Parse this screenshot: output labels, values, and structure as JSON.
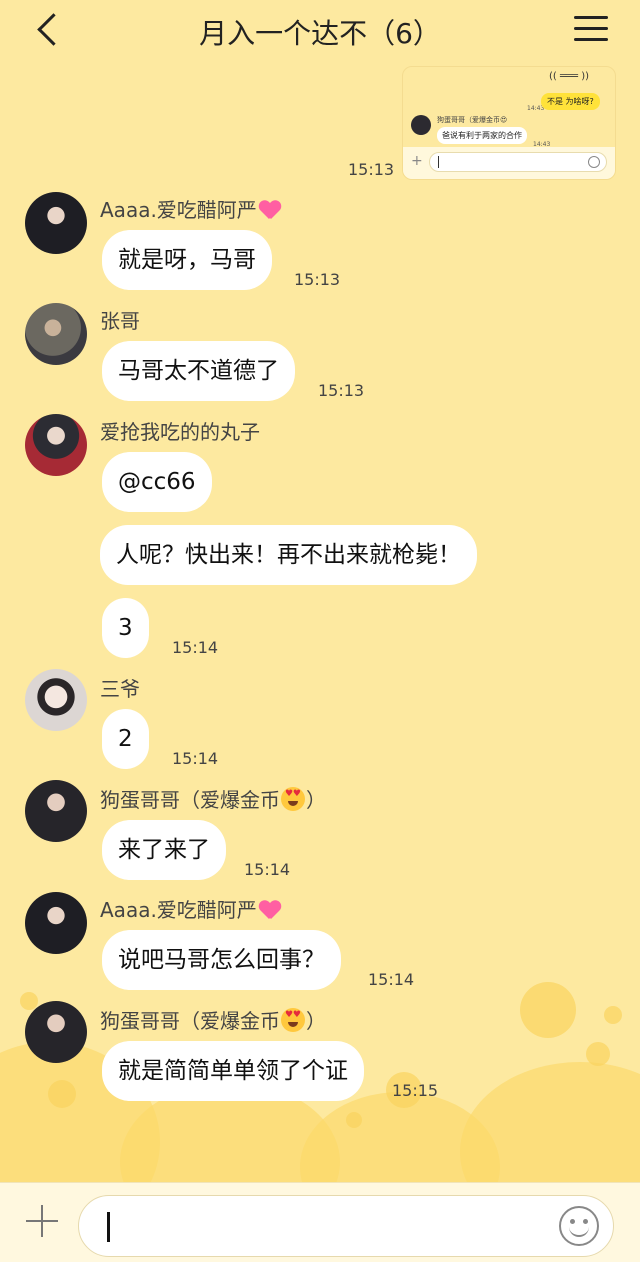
{
  "header": {
    "title": "月入一个达不（6）",
    "back_icon": "chevron-left-icon",
    "menu_icon": "menu-icon"
  },
  "screenshot_message": {
    "meme_text": "(( ═══ ))",
    "yellow_bubble": "不是 为啥呀?",
    "time_top": "14:43",
    "sender": "狗蛋哥哥（爱爆金币😍",
    "white_bubble": "爸说有利于两家的合作",
    "time_bottom": "14:43",
    "sent_time": "15:13"
  },
  "messages": [
    {
      "sender": "Aaaa.爱吃醋阿严",
      "text": "就是呀，马哥",
      "time": "15:13"
    },
    {
      "sender": "张哥",
      "text": "马哥太不道德了",
      "time": "15:13"
    },
    {
      "sender": "爱抢我吃的的丸子",
      "text": "@cc66"
    },
    {
      "text": "人呢？快出来！再不出来就枪毙！"
    },
    {
      "text": "3",
      "time": "15:14"
    },
    {
      "sender": "三爷",
      "text": "2",
      "time": "15:14"
    },
    {
      "sender_prefix": "狗蛋哥哥（爱爆金币",
      "sender_suffix": "）",
      "text": "来了来了",
      "time": "15:14"
    },
    {
      "sender": "Aaaa.爱吃醋阿严",
      "text": "说吧马哥怎么回事？",
      "time": "15:14"
    },
    {
      "sender_prefix": "狗蛋哥哥（爱爆金币",
      "sender_suffix": "）",
      "text": "就是简简单单领了个证",
      "time": "15:15"
    }
  ],
  "input_bar": {
    "plus_icon": "plus-icon",
    "emoji_icon": "smile-icon"
  }
}
